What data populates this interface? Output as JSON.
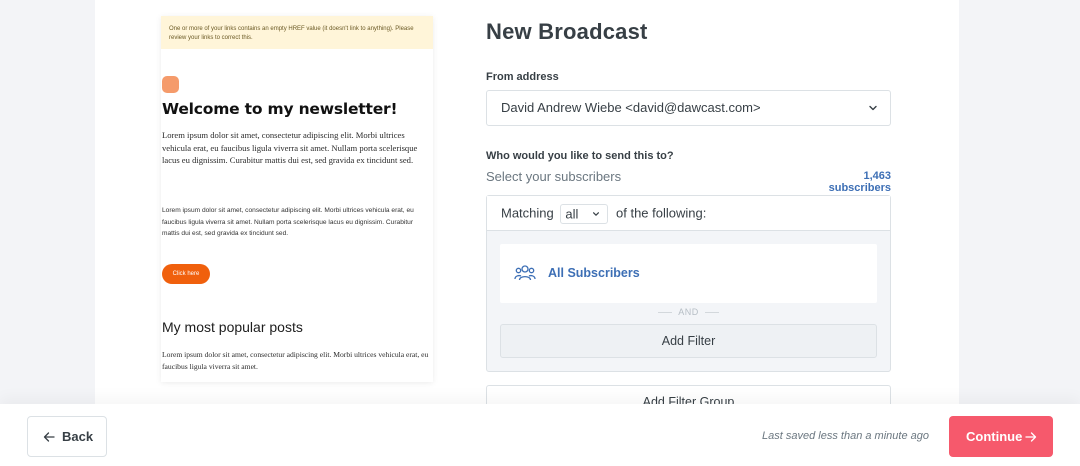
{
  "preview": {
    "warning": "One or more of your links contains an empty HREF value (it doesn't link to anything). Please review your links to correct this.",
    "title": "Welcome to my newsletter!",
    "body_serif": "Lorem ipsum dolor sit amet, consectetur adipiscing elit. Morbi ultrices vehicula erat, eu faucibus ligula viverra sit amet. Nullam porta scelerisque lacus eu dignissim. Curabitur mattis dui est, sed gravida ex tincidunt sed.",
    "body_sans": "Lorem ipsum dolor sit amet, consectetur adipiscing elit. Morbi ultrices vehicula erat, eu faucibus ligula viverra sit amet. Nullam porta scelerisque lacus eu dignissim. Curabitur mattis dui est, sed gravida ex tincidunt sed.",
    "cta": "Click here",
    "section_title": "My most popular posts",
    "body_posts": "Lorem ipsum dolor sit amet, consectetur adipiscing elit. Morbi ultrices vehicula erat, eu faucibus ligula viverra sit amet."
  },
  "form": {
    "title": "New Broadcast",
    "from_label": "From address",
    "from_value": "David Andrew Wiebe <david@dawcast.com>",
    "to_label": "Who would you like to send this to?",
    "select_subscribers": "Select your subscribers",
    "subscriber_count": "1,463 subscribers",
    "matching_prefix": "Matching",
    "matching_value": "all",
    "matching_suffix": "of the following:",
    "all_subscribers": "All Subscribers",
    "and_label": "AND",
    "add_filter": "Add Filter",
    "add_filter_group": "Add Filter Group"
  },
  "footer": {
    "back_label": "Back",
    "saved_status": "Last saved less than a minute ago",
    "continue_label": "Continue"
  },
  "colors": {
    "accent_blue": "#3d6fb5",
    "continue_red": "#f6596c",
    "cta_orange": "#f0600d",
    "warning_bg": "#fff5d9"
  },
  "icons": [
    "chevron-down-icon",
    "users-icon",
    "arrow-left-icon",
    "arrow-right-icon"
  ]
}
